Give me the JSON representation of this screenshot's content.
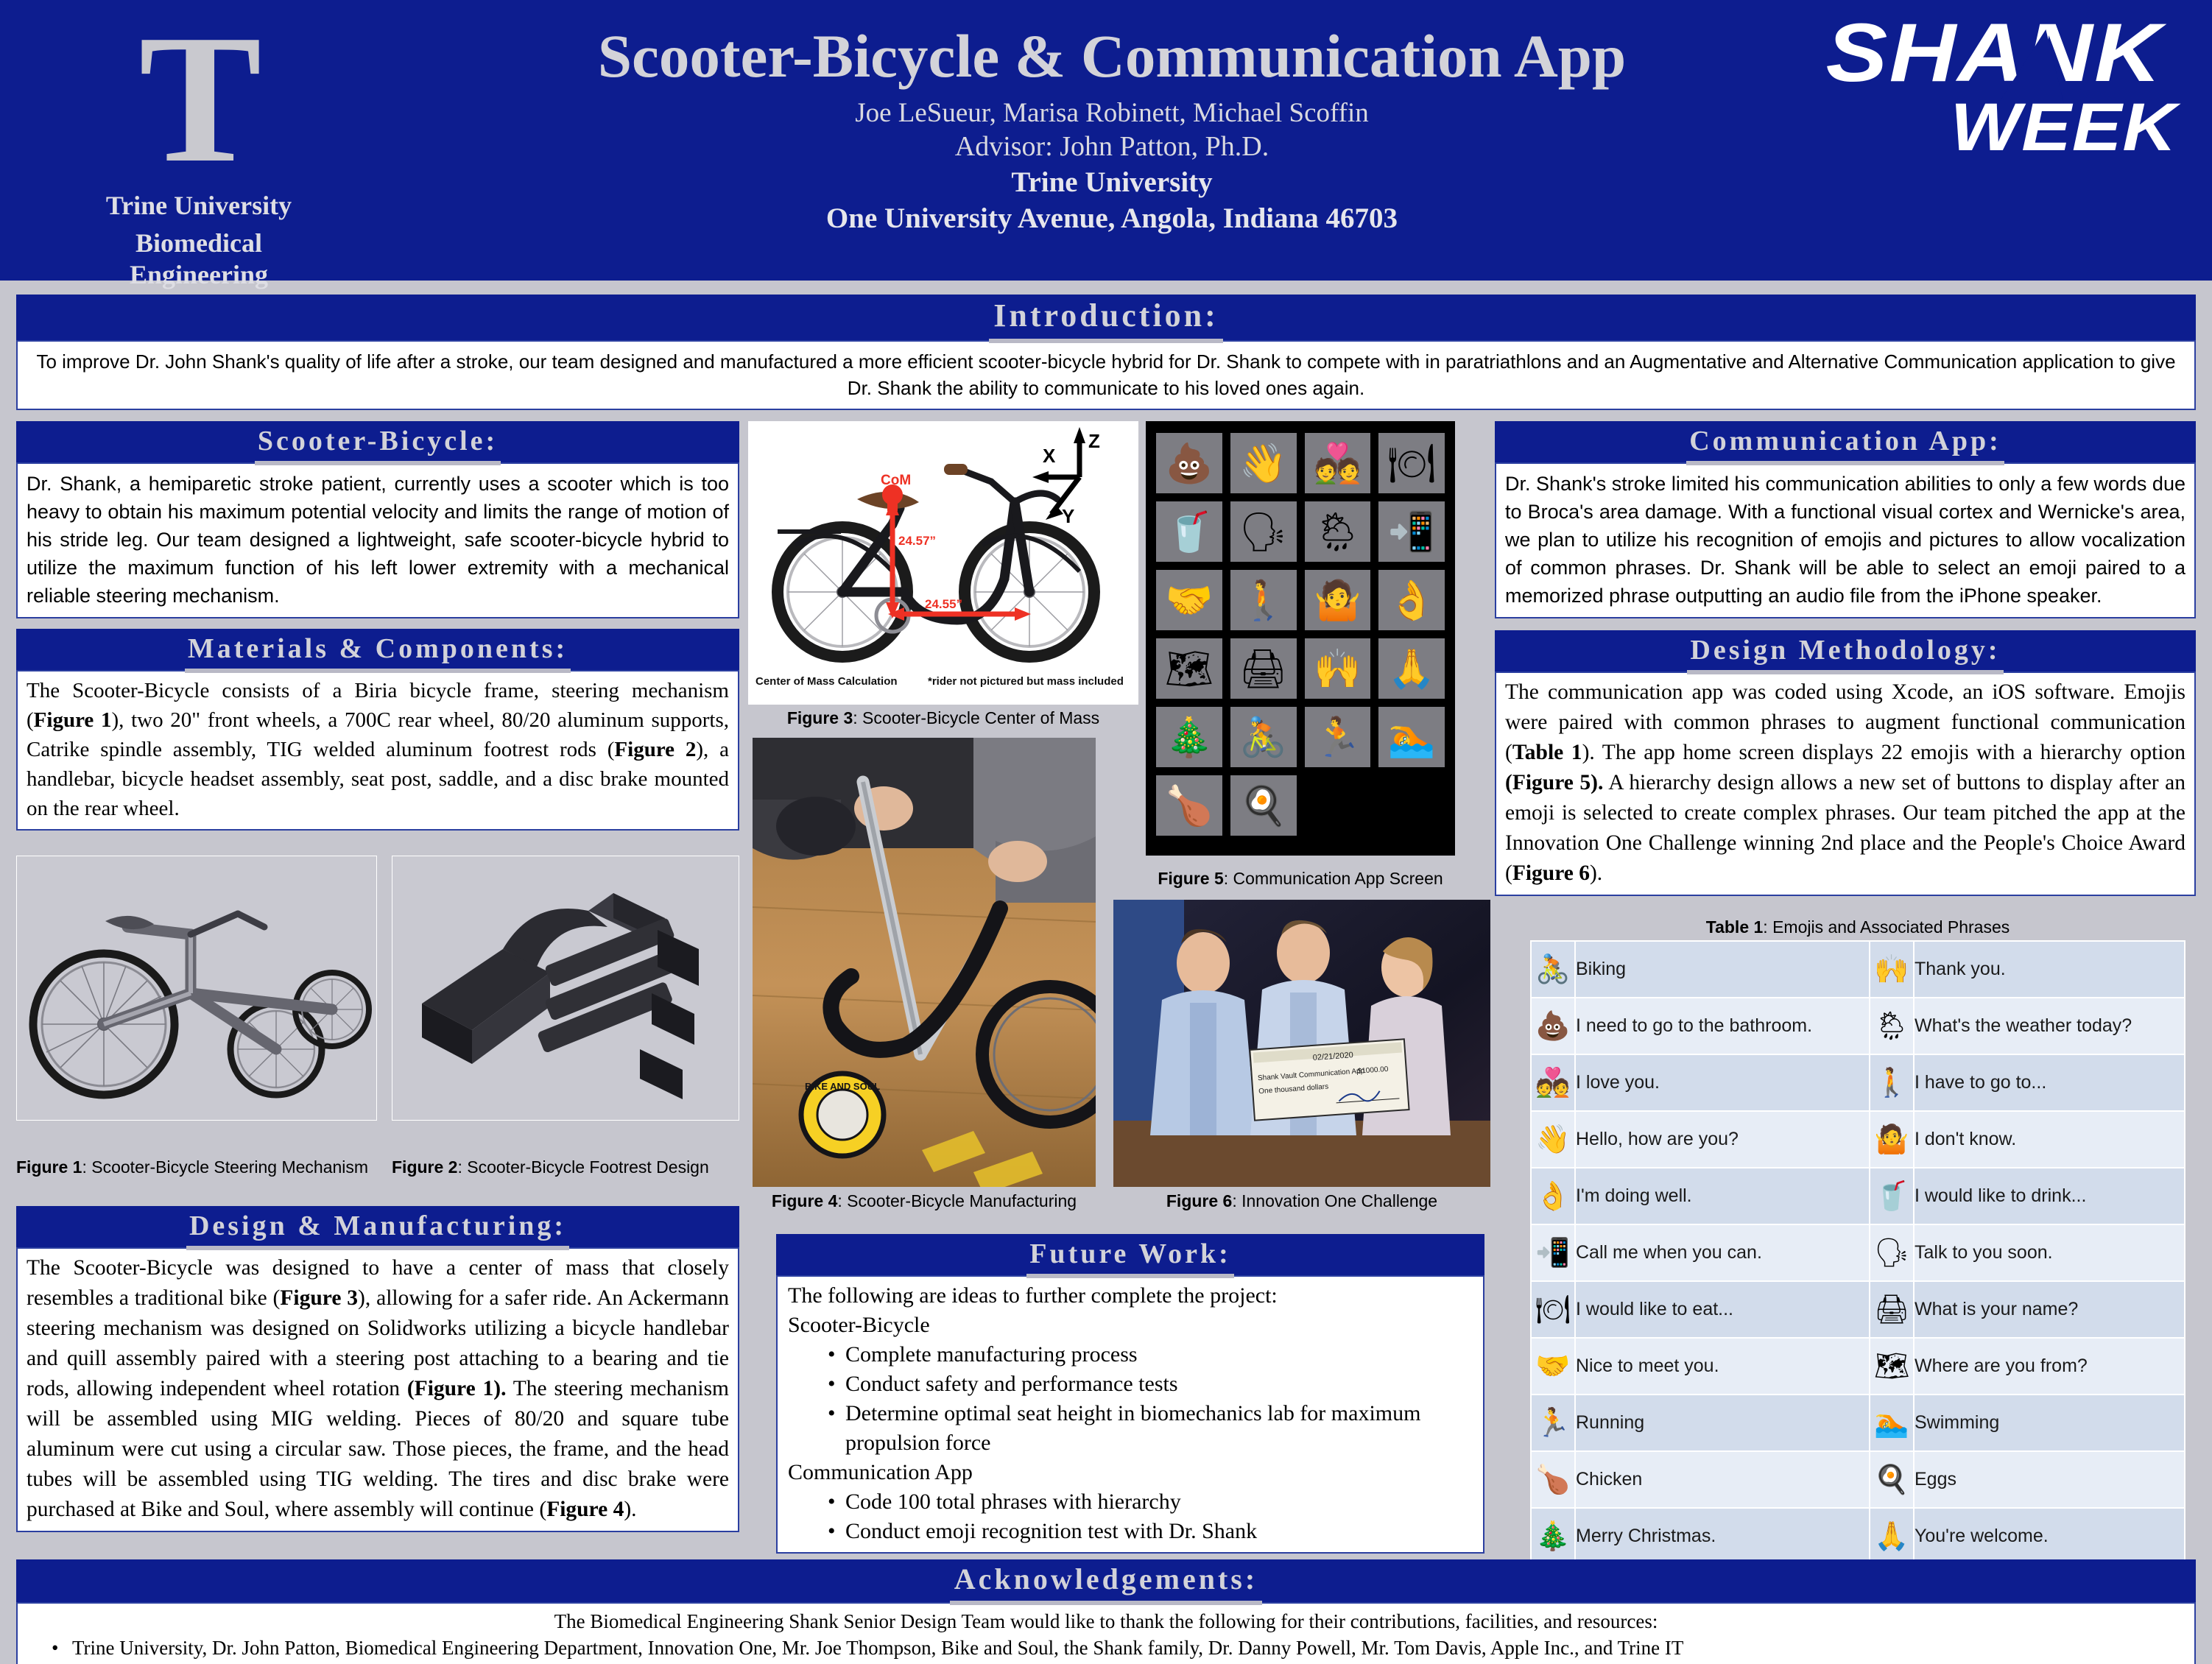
{
  "header": {
    "logo_letter": "T",
    "university": "Trine University",
    "department": "Biomedical Engineering",
    "title": "Scooter-Bicycle & Communication App",
    "authors": "Joe LeSueur, Marisa Robinett, Michael Scoffin",
    "advisor": "Advisor: John Patton, Ph.D.",
    "affiliation_line1": "Trine University",
    "affiliation_line2": "One University Avenue, Angola, Indiana 46703",
    "shank_logo_line1": "SHANK",
    "shank_logo_line2": "WEEK"
  },
  "colors": {
    "brand_blue": "#0d1d8f",
    "poster_bg": "#c6c6ce",
    "panel_border": "#2b3fa0",
    "heading_text": "#d2d2d9",
    "table_row_odd": "#d2dceb",
    "table_row_even": "#e7edf6",
    "accent_red": "#ee3124"
  },
  "introduction": {
    "heading": "Introduction:",
    "text": "To improve Dr. John Shank's quality of life after a stroke, our team designed and manufactured a more efficient scooter-bicycle hybrid for Dr. Shank to compete with in paratriathlons and an Augmentative and Alternative Communication application to give Dr. Shank the ability to communicate to his loved ones again."
  },
  "scooter_bicycle": {
    "heading": "Scooter-Bicycle:",
    "text": "Dr. Shank, a hemiparetic stroke patient, currently uses a scooter which is too heavy to obtain his maximum potential velocity and limits the range of motion of his stride leg. Our team designed a lightweight, safe scooter-bicycle hybrid to utilize the maximum function of his left lower extremity with a mechanical reliable steering mechanism."
  },
  "materials": {
    "heading": "Materials & Components:",
    "text_part1": "The Scooter-Bicycle consists of a Biria bicycle frame, steering mechanism (",
    "fig1_ref": "Figure 1",
    "text_part2": "), two 20\" front wheels, a 700C rear wheel, 80/20 aluminum supports, Catrike spindle assembly, TIG welded aluminum footrest rods (",
    "fig2_ref": "Figure 2",
    "text_part3": "), a handlebar, bicycle headset assembly, seat post, saddle, and a disc brake mounted on the rear wheel."
  },
  "design_manufacturing": {
    "heading": "Design & Manufacturing:",
    "p1": "The Scooter-Bicycle was designed to have a center of mass that closely resembles a traditional bike (",
    "fig3_ref": "Figure 3",
    "p2": "), allowing for a safer ride. An Ackermann steering mechanism was designed on Solidworks utilizing a bicycle handlebar and quill assembly paired with a steering post attaching to a bearing and tie rods, allowing independent wheel rotation ",
    "fig1_ref": "(Figure 1).",
    "p3": " The steering mechanism will be assembled using MIG welding. Pieces of 80/20 and square tube aluminum were cut using a circular saw. Those pieces, the frame, and the head tubes will be assembled using TIG welding. The tires and disc brake were purchased at Bike and Soul, where assembly will continue (",
    "fig4_ref": "Figure 4",
    "p4": ")."
  },
  "communication_app": {
    "heading": "Communication App:",
    "text": "Dr. Shank's stroke limited his communication abilities to only a few words due to Broca's area damage. With a functional visual cortex and Wernicke's area, we plan to utilize his recognition of emojis and pictures to allow vocalization of common phrases. Dr. Shank will be able to select an emoji paired to a memorized phrase outputting an audio file from the iPhone speaker."
  },
  "design_methodology": {
    "heading": "Design Methodology:",
    "p1": "The communication app was coded using Xcode, an iOS software. Emojis were paired with common phrases to augment functional communication (",
    "table1_ref": "Table 1",
    "p2": "). The app home screen displays 22 emojis with a hierarchy option ",
    "fig5_ref": "(Figure 5).",
    "p3": " A hierarchy design allows a new set of buttons to display after an emoji is selected to create complex phrases. Our team pitched the app at the Innovation One Challenge winning 2nd place and the People's Choice Award (",
    "fig6_ref": "Figure 6",
    "p4": ")."
  },
  "future_work": {
    "heading": "Future Work:",
    "intro": "The following are ideas to further complete the project:",
    "group1_title": "Scooter-Bicycle",
    "group1_items": [
      "Complete manufacturing process",
      "Conduct safety and performance tests",
      "Determine optimal seat height in biomechanics lab for maximum propulsion force"
    ],
    "group2_title": "Communication App",
    "group2_items": [
      "Code 100 total phrases with hierarchy",
      "Conduct emoji recognition test with Dr. Shank"
    ]
  },
  "figures": {
    "fig1_label": "Figure 1",
    "fig1_caption": ": Scooter-Bicycle Steering Mechanism",
    "fig2_label": "Figure 2",
    "fig2_caption": ": Scooter-Bicycle Footrest Design",
    "fig3_label": "Figure 3",
    "fig3_caption": ": Scooter-Bicycle Center of Mass",
    "fig4_label": "Figure 4",
    "fig4_caption": ": Scooter-Bicycle Manufacturing",
    "fig5_label": "Figure 5",
    "fig5_caption": ": Communication App Screen",
    "fig6_label": "Figure 6",
    "fig6_caption": ": Innovation One Challenge"
  },
  "fig3_annotations": {
    "com_label": "CoM",
    "vertical_dim": "24.57”",
    "horizontal_dim": "24.55”",
    "axis_x": "X",
    "axis_y": "Y",
    "axis_z": "Z",
    "caption_left": "Center of Mass Calculation",
    "caption_right": "*rider not pictured but mass included"
  },
  "fig6_check": {
    "date": "02/21/2020",
    "payee": "Shank Vault Communication App",
    "amount_words": "One thousand dollars",
    "amount_numeric": "$1000.00"
  },
  "table1": {
    "title_label": "Table 1",
    "title_rest": ": Emojis and Associated Phrases",
    "rows": [
      {
        "emoji_left": "🚴",
        "emoji_left_name": "cyclist-emoji",
        "phrase_left": "Biking",
        "emoji_right": "🙌",
        "emoji_right_name": "raising-hands-emoji",
        "phrase_right": "Thank you."
      },
      {
        "emoji_left": "💩",
        "emoji_left_name": "poop-emoji",
        "phrase_left": "I need to go to the bathroom.",
        "emoji_right": "🌦",
        "emoji_right_name": "sun-behind-rain-cloud-emoji",
        "phrase_right": "What's the weather today?"
      },
      {
        "emoji_left": "💑",
        "emoji_left_name": "couple-with-heart-emoji",
        "phrase_left": "I love you.",
        "emoji_right": "🚶",
        "emoji_right_name": "person-walking-emoji",
        "phrase_right": "I have to go to..."
      },
      {
        "emoji_left": "👋",
        "emoji_left_name": "waving-hand-emoji",
        "phrase_left": "Hello, how are you?",
        "emoji_right": "🤷",
        "emoji_right_name": "person-shrugging-emoji",
        "phrase_right": "I don't know."
      },
      {
        "emoji_left": "👌",
        "emoji_left_name": "ok-hand-emoji",
        "phrase_left": "I'm doing well.",
        "emoji_right": "🥤",
        "emoji_right_name": "cup-with-straw-emoji",
        "phrase_right": "I would like to drink..."
      },
      {
        "emoji_left": "📲",
        "emoji_left_name": "mobile-phone-with-arrow-emoji",
        "phrase_left": "Call me when you can.",
        "emoji_right": "🗣",
        "emoji_right_name": "speaking-head-emoji",
        "phrase_right": "Talk to you soon."
      },
      {
        "emoji_left": "🍽",
        "emoji_left_name": "fork-and-knife-with-plate-emoji",
        "phrase_left": "I would like to eat...",
        "emoji_right": "🖨",
        "emoji_right_name": "printer-emoji",
        "phrase_right": "What is your name?"
      },
      {
        "emoji_left": "🤝",
        "emoji_left_name": "handshake-emoji",
        "phrase_left": "Nice to meet you.",
        "emoji_right": "🗺",
        "emoji_right_name": "world-map-emoji",
        "phrase_right": "Where are you from?"
      },
      {
        "emoji_left": "🏃",
        "emoji_left_name": "person-running-emoji",
        "phrase_left": "Running",
        "emoji_right": "🏊",
        "emoji_right_name": "person-swimming-emoji",
        "phrase_right": "Swimming"
      },
      {
        "emoji_left": "🍗",
        "emoji_left_name": "poultry-leg-emoji",
        "phrase_left": "Chicken",
        "emoji_right": "🍳",
        "emoji_right_name": "cooking-egg-emoji",
        "phrase_right": "Eggs"
      },
      {
        "emoji_left": "🎄",
        "emoji_left_name": "christmas-tree-emoji",
        "phrase_left": "Merry Christmas.",
        "emoji_right": "🙏",
        "emoji_right_name": "folded-hands-emoji",
        "phrase_right": "You're welcome."
      }
    ]
  },
  "fig5_app_grid": {
    "emojis": [
      "💩",
      "👋",
      "💑",
      "🍽",
      "🥤",
      "🗣",
      "🌦",
      "📲",
      "🤝",
      "🚶",
      "🤷",
      "👌",
      "🗺",
      "🖨",
      "🙌",
      "🙏",
      "🎄",
      "🚴",
      "🏃",
      "🏊",
      "🍗",
      "🍳"
    ]
  },
  "acknowledgements": {
    "heading": "Acknowledgements:",
    "intro": "The Biomedical Engineering Shank Senior Design Team would like to thank the following for their contributions, facilities, and resources:",
    "bullet": "Trine University, Dr. John Patton, Biomedical Engineering Department, Innovation One, Mr. Joe Thompson, Bike and Soul, the Shank family, Dr. Danny Powell, Mr. Tom Davis, Apple Inc., and Trine IT"
  }
}
